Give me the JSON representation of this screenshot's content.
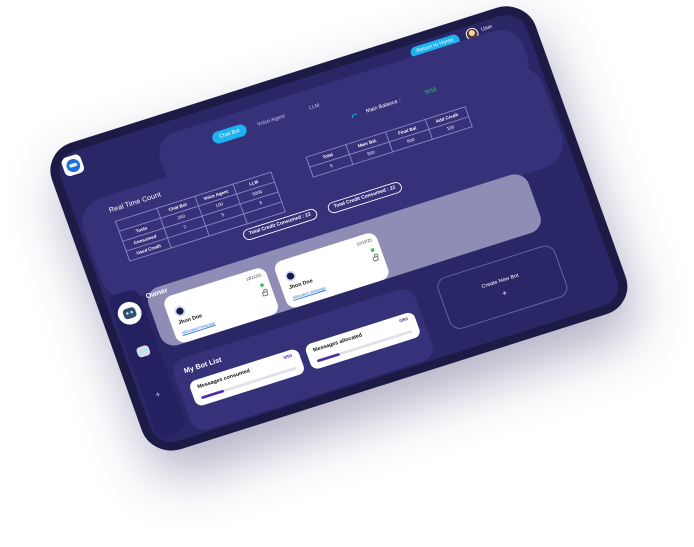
{
  "header": {
    "return_label": "Return to Home",
    "user_name": "User"
  },
  "tabs": [
    {
      "label": "Chat Bot",
      "active": true
    },
    {
      "label": "Voice Agent",
      "active": false
    },
    {
      "label": "LLM",
      "active": false
    }
  ],
  "balance": {
    "label": "Main Balance :",
    "value": "5016",
    "value_color": "#2ee05f"
  },
  "realtime": {
    "title": "Real Time Count",
    "left_table": {
      "headers": [
        "",
        "Chat Bot",
        "Voice Agent",
        "LLM"
      ],
      "rows": [
        [
          "Tools",
          "200",
          "100",
          "5000"
        ],
        [
          "Consumed",
          "2",
          "5",
          "5"
        ],
        [
          "Used Credit",
          "",
          "",
          ""
        ]
      ]
    },
    "right_table": {
      "headers": [
        "Total",
        "Main Bal.",
        "Final Bal",
        "Add Credit"
      ],
      "rows": [
        [
          "5",
          "500",
          "500",
          "100"
        ]
      ]
    },
    "total_left": "Total Credit Consumed : 22",
    "total_right": "Total Credit Consumed : 22"
  },
  "owner": {
    "title": "Owner",
    "cards": [
      {
        "name": "Jhon Doe",
        "date": "12/12/25",
        "link": "Allocated message"
      },
      {
        "name": "Jhon Doe",
        "date": "12/12/25",
        "link": "Allocated message"
      }
    ]
  },
  "bot_list": {
    "title": "My Bot List",
    "stats": [
      {
        "label": "Messages consumed",
        "value": "0/50",
        "progress": 0.24
      },
      {
        "label": "Messages allocated",
        "value": "0/50",
        "progress": 0.24
      }
    ]
  },
  "create_bot": {
    "label": "Create New Bot",
    "plus": "+"
  },
  "rail": {
    "add": "+"
  },
  "colors": {
    "accent": "#1fb2f0",
    "panel": "#35327a",
    "background": "#2a2766",
    "progress": "#4b2ea8"
  }
}
